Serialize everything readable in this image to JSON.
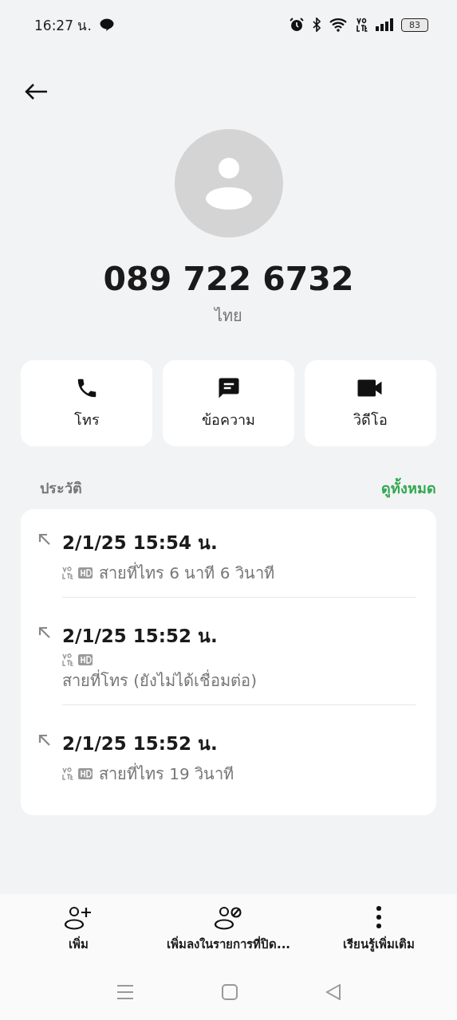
{
  "status_bar": {
    "time": "16:27 น.",
    "battery": "83"
  },
  "contact": {
    "number": "089 722 6732",
    "location": "ไทย"
  },
  "actions": [
    {
      "kind": "call",
      "label": "โทร"
    },
    {
      "kind": "message",
      "label": "ข้อความ"
    },
    {
      "kind": "video",
      "label": "วิดีโอ"
    }
  ],
  "history": {
    "title": "ประวัติ",
    "see_all": "ดูทั้งหมด",
    "entries": [
      {
        "kind": "inline",
        "time": "2/1/25 15:54 น.",
        "detail": "สายที่ไทร  6 นาที 6 วินาที"
      },
      {
        "kind": "stacked",
        "time": "2/1/25 15:52 น.",
        "detail": "สายที่โทร (ยังไม่ได้เชื่อมต่อ)"
      },
      {
        "kind": "inline",
        "time": "2/1/25 15:52 น.",
        "detail": "สายที่ไทร  19 วินาที"
      }
    ]
  },
  "bottom_actions": [
    {
      "kind": "add",
      "label": "เพิ่ม"
    },
    {
      "kind": "block",
      "label": "เพิ่มลงในรายการที่ปิด..."
    },
    {
      "kind": "more",
      "label": "เรียนรู้เพิ่มเติม"
    }
  ]
}
